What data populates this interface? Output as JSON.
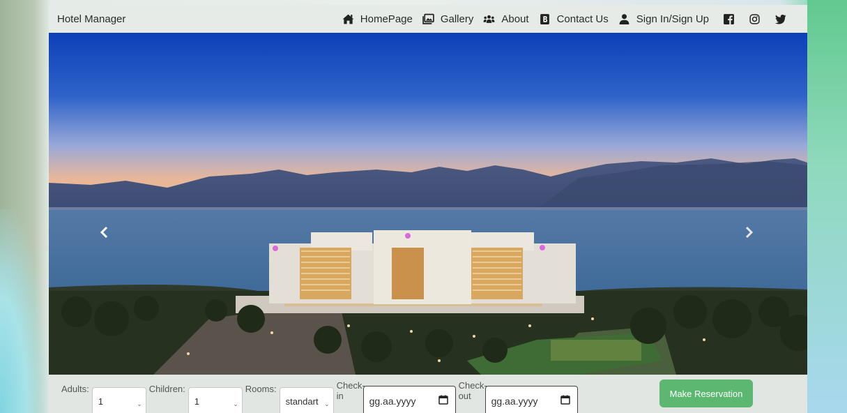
{
  "navbar": {
    "brand": "Hotel Manager",
    "items": [
      {
        "label": "HomePage",
        "icon": "home-icon"
      },
      {
        "label": "Gallery",
        "icon": "images-icon"
      },
      {
        "label": "About",
        "icon": "users-icon"
      },
      {
        "label": "Contact Us",
        "icon": "address-book-icon"
      },
      {
        "label": "Sign In/Sign Up",
        "icon": "user-icon"
      }
    ],
    "social": [
      "facebook-icon",
      "instagram-icon",
      "twitter-icon"
    ]
  },
  "carousel": {
    "prev_icon": "chevron-left-icon",
    "next_icon": "chevron-right-icon"
  },
  "reservation": {
    "adults_label": "Adults:",
    "adults_value": "1",
    "children_label": "Children:",
    "children_value": "1",
    "rooms_label": "Rooms:",
    "rooms_value": "standart",
    "checkin_label": "Check-in",
    "checkin_placeholder": "gg.aa.yyyy",
    "checkout_label": "Check-out",
    "checkout_placeholder": "gg.aa.yyyy",
    "submit_label": "Make Reservation"
  },
  "colors": {
    "navbar_bg": "#e7ebe8",
    "button_green": "#5cb870"
  }
}
